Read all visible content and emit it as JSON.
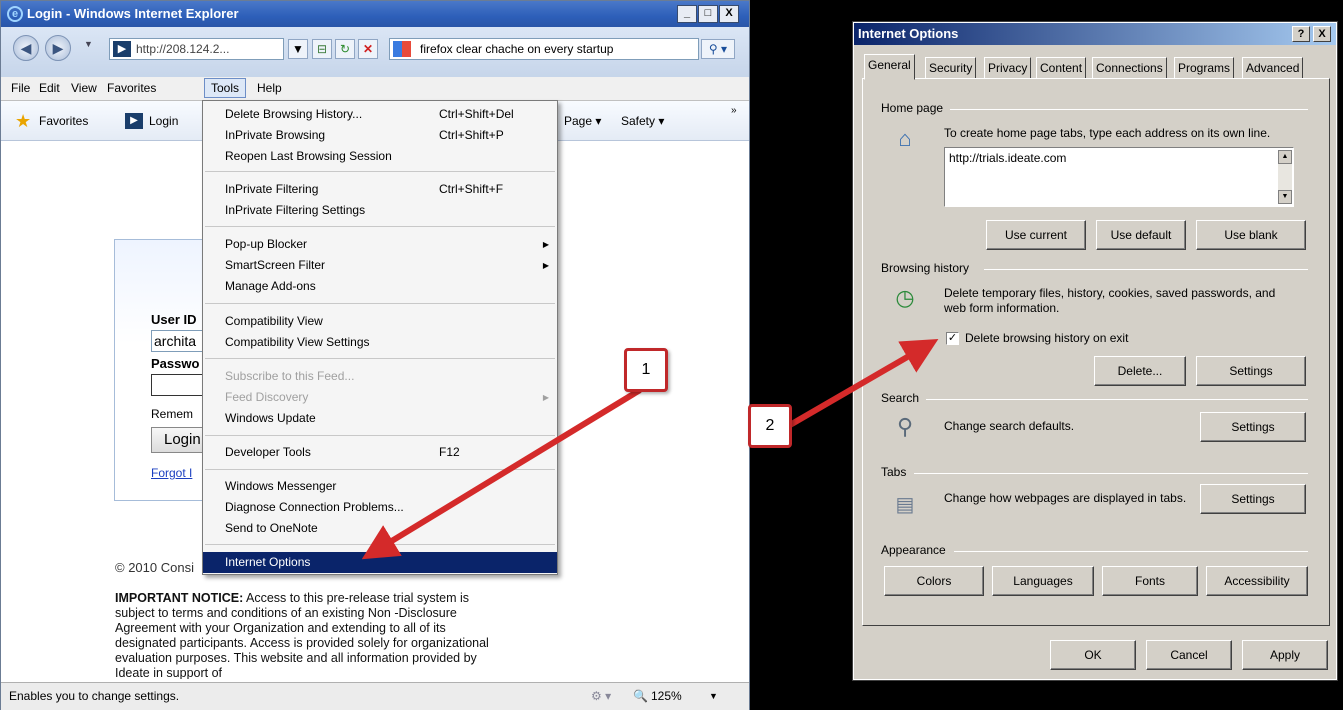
{
  "ie": {
    "title": "Login - Windows Internet Explorer",
    "address": "http://208.124.2...",
    "search": "firefox clear chache on every startup",
    "menubar": [
      "File",
      "Edit",
      "View",
      "Favorites",
      "Tools",
      "Help"
    ],
    "favorites_label": "Favorites",
    "login_tab": "Login",
    "page_menu": "Page ▾",
    "safety_menu": "Safety ▾",
    "login_form": {
      "user_id_label": "User ID",
      "user_id_value": "archita",
      "password_label": "Passwo",
      "remember_label": "Remem",
      "login_button": "Login",
      "forgot_link": "Forgot I"
    },
    "copyright": "© 2010 Consi",
    "notice_bold": "IMPORTANT NOTICE:",
    "notice_text": " Access to this pre-release trial system is subject to terms and conditions of an existing Non -Disclosure Agreement with your Organization and extending to all of its designated participants. Access is provided solely for organizational evaluation purposes. This website and all information provided by Ideate in support of",
    "status_text": "Enables you to change settings.",
    "zoom": "125%"
  },
  "tools_menu": {
    "items": [
      {
        "label": "Delete Browsing History...",
        "shortcut": "Ctrl+Shift+Del"
      },
      {
        "label": "InPrivate Browsing",
        "shortcut": "Ctrl+Shift+P"
      },
      {
        "label": "Reopen Last Browsing Session",
        "shortcut": ""
      },
      {
        "label": "InPrivate Filtering",
        "shortcut": "Ctrl+Shift+F"
      },
      {
        "label": "InPrivate Filtering Settings",
        "shortcut": ""
      },
      {
        "label": "Pop-up Blocker",
        "shortcut": ""
      },
      {
        "label": "SmartScreen Filter",
        "shortcut": ""
      },
      {
        "label": "Manage Add-ons",
        "shortcut": ""
      },
      {
        "label": "Compatibility View",
        "shortcut": ""
      },
      {
        "label": "Compatibility View Settings",
        "shortcut": ""
      },
      {
        "label": "Subscribe to this Feed...",
        "shortcut": ""
      },
      {
        "label": "Feed Discovery",
        "shortcut": ""
      },
      {
        "label": "Windows Update",
        "shortcut": ""
      },
      {
        "label": "Developer Tools",
        "shortcut": "F12"
      },
      {
        "label": "Windows Messenger",
        "shortcut": ""
      },
      {
        "label": "Diagnose Connection Problems...",
        "shortcut": ""
      },
      {
        "label": "Send to OneNote",
        "shortcut": ""
      },
      {
        "label": "Internet Options",
        "shortcut": ""
      }
    ]
  },
  "dialog": {
    "title": "Internet Options",
    "help_btn": "?",
    "close_btn": "X",
    "tabs": [
      "General",
      "Security",
      "Privacy",
      "Content",
      "Connections",
      "Programs",
      "Advanced"
    ],
    "home_page": {
      "label": "Home page",
      "desc": "To create home page tabs, type each address on its own line.",
      "value": "http://trials.ideate.com",
      "buttons": [
        "Use current",
        "Use default",
        "Use blank"
      ]
    },
    "browsing_history": {
      "label": "Browsing history",
      "desc": "Delete temporary files, history, cookies, saved passwords, and web form information.",
      "checkbox_label": "Delete browsing history on exit",
      "checked": true,
      "delete_btn": "Delete...",
      "settings_btn": "Settings"
    },
    "search": {
      "label": "Search",
      "desc": "Change search defaults.",
      "settings_btn": "Settings"
    },
    "tabs_group": {
      "label": "Tabs",
      "desc": "Change how webpages are displayed in tabs.",
      "settings_btn": "Settings"
    },
    "appearance": {
      "label": "Appearance",
      "buttons": [
        "Colors",
        "Languages",
        "Fonts",
        "Accessibility"
      ]
    },
    "footer": [
      "OK",
      "Cancel",
      "Apply"
    ]
  },
  "callouts": [
    "1",
    "2"
  ],
  "colors": {
    "arrow": "#d42a2a",
    "selection": "#0a246a"
  }
}
